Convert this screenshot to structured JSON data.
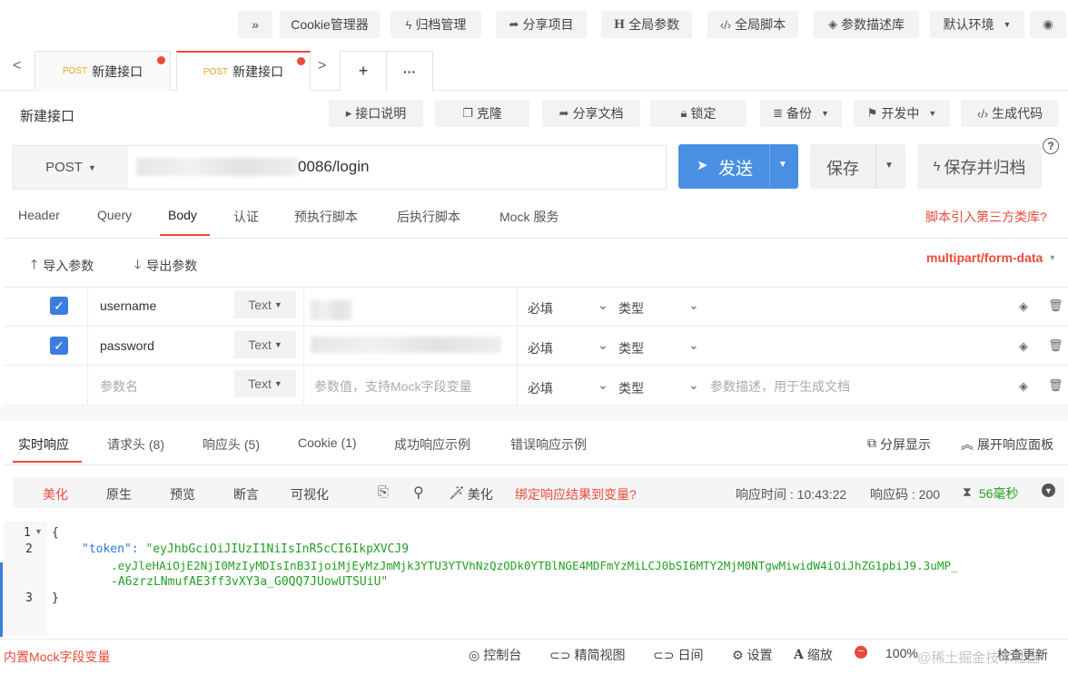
{
  "toolbar": {
    "more": "»",
    "cookie_manager": "Cookie管理器",
    "archive_manager": "归档管理",
    "share_project": "分享项目",
    "global_params": "全局参数",
    "global_scripts": "全局脚本",
    "param_library": "参数描述库",
    "default_env": "默认环境"
  },
  "tabs": {
    "prev": "<",
    "next": ">",
    "add": "+",
    "more": "···",
    "items": [
      {
        "method": "POST",
        "label": "新建接口"
      },
      {
        "method": "POST",
        "label": "新建接口"
      }
    ]
  },
  "request": {
    "name": "新建接口",
    "doc_btn": "接口说明",
    "clone_btn": "克隆",
    "share_doc_btn": "分享文档",
    "lock_btn": "锁定",
    "backup_btn": "备份",
    "status_btn": "开发中",
    "gen_code_btn": "生成代码",
    "method": "POST",
    "url_suffix": "0086/login",
    "send_btn": "发送",
    "save_btn": "保存",
    "save_archive_btn": "保存并归档",
    "help": "?"
  },
  "subtabs": {
    "items": [
      "Header",
      "Query",
      "Body",
      "认证",
      "预执行脚本",
      "后执行脚本",
      "Mock 服务"
    ],
    "active": "Body",
    "third_party_link": "脚本引入第三方类库?"
  },
  "body": {
    "import_btn": "导入参数",
    "export_btn": "导出参数",
    "content_type": "multipart/form-data",
    "rows": [
      {
        "name": "username",
        "type": "Text",
        "required": "必填",
        "kind": "类型",
        "checked": true
      },
      {
        "name": "password",
        "type": "Text",
        "required": "必填",
        "kind": "类型",
        "checked": true
      },
      {
        "name": "参数名",
        "type": "Text",
        "required": "必填",
        "kind": "类型",
        "value_placeholder": "参数值，支持Mock字段变量",
        "desc_placeholder": "参数描述，用于生成文档",
        "checked": false
      }
    ]
  },
  "response": {
    "tabs": [
      "实时响应",
      "请求头 (8)",
      "响应头 (5)",
      "Cookie (1)",
      "成功响应示例",
      "错误响应示例"
    ],
    "active_tab": "实时响应",
    "split_view": "分屏显示",
    "expand_panel": "展开响应面板",
    "views": [
      "美化",
      "原生",
      "预览",
      "断言",
      "可视化"
    ],
    "active_view": "美化",
    "beautify": "美化",
    "bind_vars": "绑定响应结果到变量?",
    "time_label": "响应时间 : 10:43:22",
    "code_label": "响应码 : 200",
    "duration": "56毫秒",
    "code_lines": [
      {
        "no": "1",
        "text": "{"
      },
      {
        "no": "2",
        "text": "\"token\": \"eyJhbGciOiJIUzI1NiIsInR5cCI6IkpXVCJ9"
      },
      {
        "no": "",
        "text": ".eyJleHAiOjE2NjI0MzIyMDIsInB3IjoiMjEyMzJmMjk3YTU3YTVhNzQzODk0YTBlNGE4MDFmYzMiLCJ0bSI6MTY2MjM0NTgwMiwidW4iOiJhZG1pbiJ9.3uMP_"
      },
      {
        "no": "",
        "text": "-A6zrzLNmufAE3ff3vXY3a_G0QQ7JUowUTSUiU\""
      },
      {
        "no": "3",
        "text": "}"
      }
    ]
  },
  "statusbar": {
    "mock_vars": "内置Mock字段变量",
    "console": "控制台",
    "compact": "精简视图",
    "day": "日间",
    "settings": "设置",
    "zoom": "缩放",
    "zoom_level": "100%",
    "update": "检查更新",
    "watermark": "@稀土掘金技术社区"
  },
  "colors": {
    "accent": "#e94b3c",
    "primary": "#4a90e2",
    "checkbox": "#3b7ddd",
    "json_key": "#2b7bd6",
    "json_string": "#22a022"
  }
}
